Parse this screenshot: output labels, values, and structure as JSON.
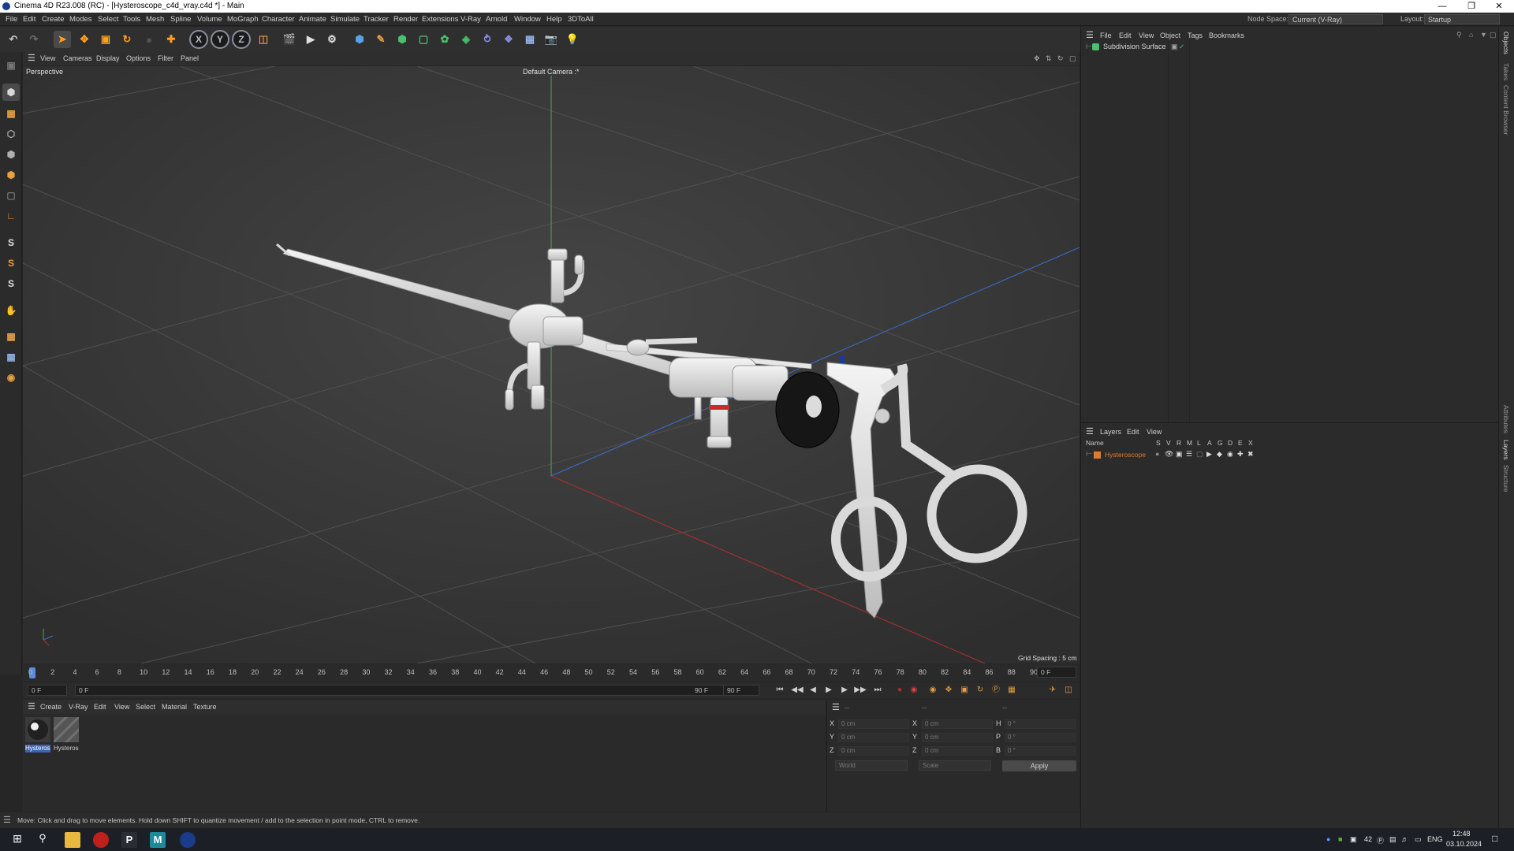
{
  "window": {
    "title": "Cinema 4D R23.008 (RC) - [Hysteroscope_c4d_vray.c4d *] - Main",
    "controls": [
      "—",
      "❐",
      "✕"
    ]
  },
  "menubar": {
    "items": [
      "File",
      "Edit",
      "Create",
      "Modes",
      "Select",
      "Tools",
      "Mesh",
      "Spline",
      "Volume",
      "MoGraph",
      "Character",
      "Animate",
      "Simulate",
      "Tracker",
      "Render",
      "Extensions",
      "V-Ray",
      "Arnold",
      "Window",
      "Help",
      "3DToAll"
    ],
    "node_space_label": "Node Space:",
    "node_space_value": "Current (V-Ray)",
    "layout_label": "Layout:",
    "layout_value": "Startup"
  },
  "toolbar": {
    "axis_x": "X",
    "axis_y": "Y",
    "axis_z": "Z"
  },
  "left_palette": {
    "s_labels": [
      "S",
      "S",
      "S"
    ]
  },
  "viewport": {
    "menu": [
      "View",
      "Cameras",
      "Display",
      "Options",
      "Filter",
      "Panel"
    ],
    "projection": "Perspective",
    "camera": "Default Camera :*",
    "grid_spacing": "Grid Spacing : 5 cm"
  },
  "timeline": {
    "ticks": [
      "0",
      "2",
      "4",
      "6",
      "8",
      "10",
      "12",
      "14",
      "16",
      "18",
      "20",
      "22",
      "24",
      "26",
      "28",
      "30",
      "32",
      "34",
      "36",
      "38",
      "40",
      "42",
      "44",
      "46",
      "48",
      "50",
      "52",
      "54",
      "56",
      "58",
      "60",
      "62",
      "64",
      "66",
      "68",
      "70",
      "72",
      "74",
      "76",
      "78",
      "80",
      "82",
      "84",
      "86",
      "88",
      "90"
    ],
    "current_frame": "0 F",
    "start_field": "0 F",
    "range_start": "0 F",
    "range_end": "90 F",
    "end_field": "90 F"
  },
  "materials": {
    "menu": [
      "Create",
      "V-Ray",
      "Edit",
      "View",
      "Select",
      "Material",
      "Texture"
    ],
    "items": [
      {
        "label": "Hysteros"
      },
      {
        "label": "Hysteros"
      }
    ]
  },
  "coordinates": {
    "header": [
      "--",
      "--",
      "--"
    ],
    "rows": [
      {
        "a": "X",
        "av": "0 cm",
        "b": "X",
        "bv": "0 cm",
        "c": "H",
        "cv": "0 °"
      },
      {
        "a": "Y",
        "av": "0 cm",
        "b": "Y",
        "bv": "0 cm",
        "c": "P",
        "cv": "0 °"
      },
      {
        "a": "Z",
        "av": "0 cm",
        "b": "Z",
        "bv": "0 cm",
        "c": "B",
        "cv": "0 °"
      }
    ],
    "mode_world": "World",
    "mode_scale": "Scale",
    "apply": "Apply"
  },
  "status": {
    "text": "Move: Click and drag to move elements. Hold down SHIFT to quantize movement / add to the selection in point mode, CTRL to remove."
  },
  "objects_panel": {
    "menu": [
      "File",
      "Edit",
      "View",
      "Object",
      "Tags",
      "Bookmarks"
    ],
    "items": [
      {
        "name": "Subdivision Surface"
      }
    ]
  },
  "layers_panel": {
    "menu": [
      "Layers",
      "Edit",
      "View"
    ],
    "columns": [
      "Name",
      "S",
      "V",
      "R",
      "M",
      "L",
      "A",
      "G",
      "D",
      "E",
      "X"
    ],
    "items": [
      {
        "name": "Hysteroscope",
        "color": "#e07a2e"
      }
    ]
  },
  "side_tabs": [
    "Objects",
    "Takes",
    "Content Browser",
    "Attributes",
    "Layers",
    "Structure"
  ],
  "taskbar": {
    "tray": {
      "temp": "42",
      "lang": "ENG",
      "time": "12:48",
      "date": "03.10.2024"
    }
  },
  "colors": {
    "accent_blue": "#3d63b8",
    "layer_orange": "#e07a2e",
    "axis_green": "#3fae5a",
    "axis_red": "#b03030",
    "axis_blue": "#3a6fd0"
  }
}
